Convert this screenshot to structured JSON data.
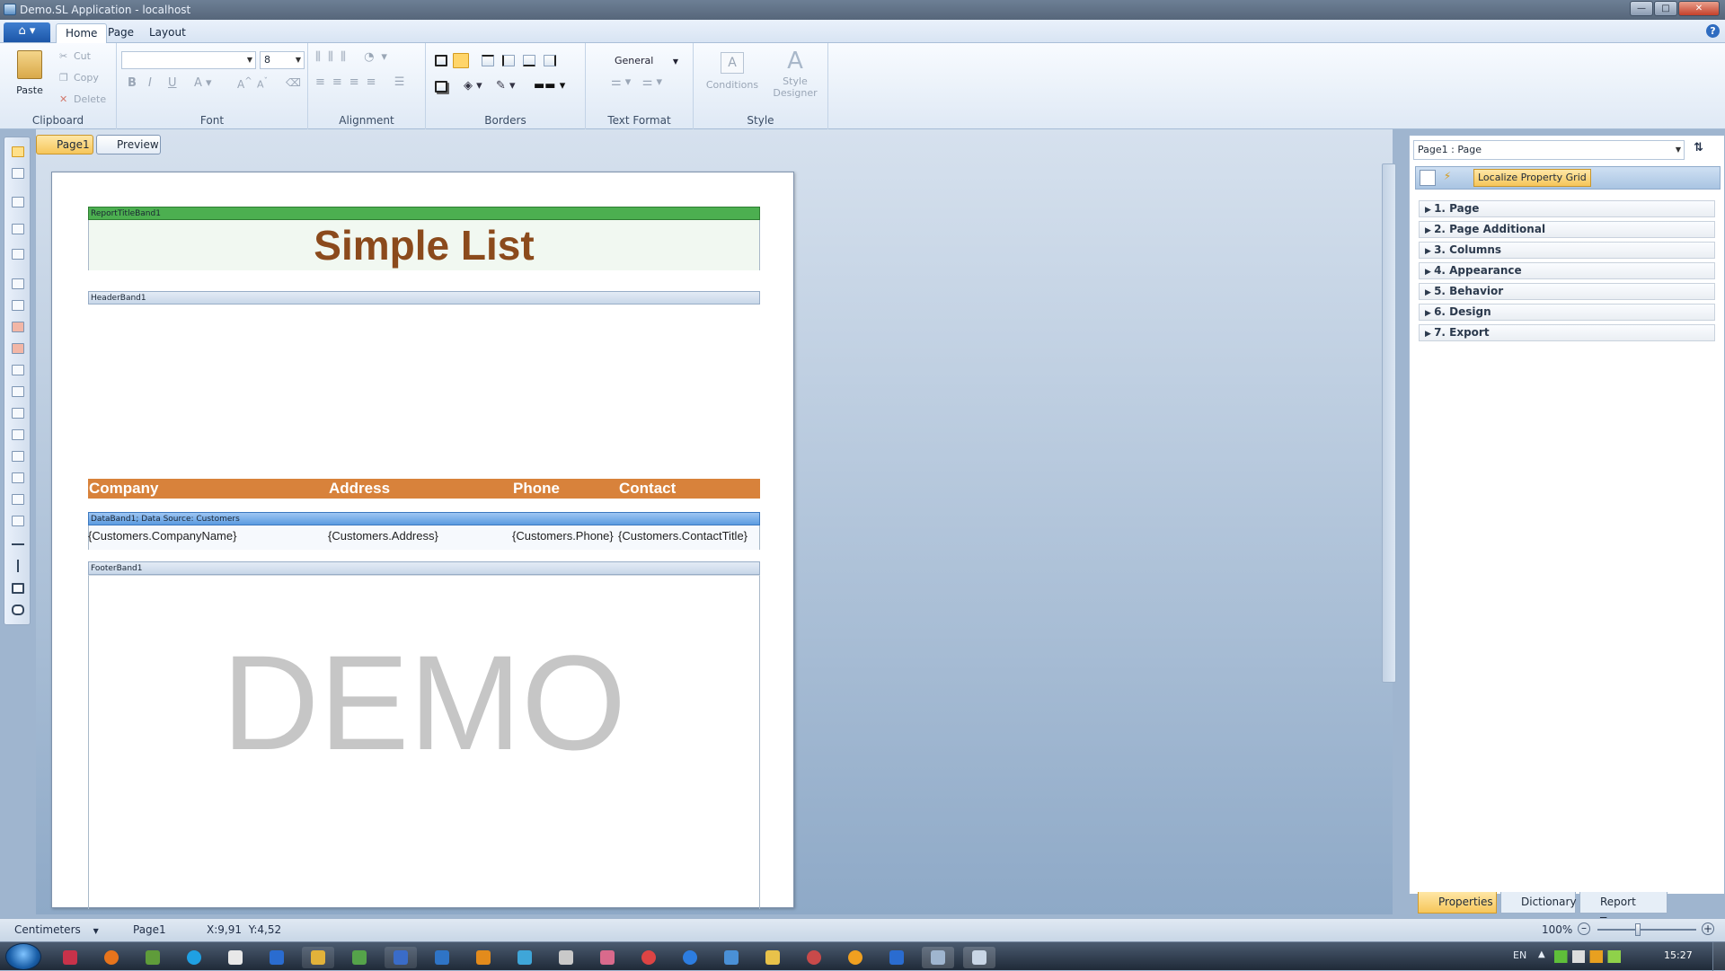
{
  "window": {
    "title": "Demo.SL Application - localhost",
    "minimize": "—",
    "maximize": "□",
    "close": "✕"
  },
  "ribbon": {
    "tabs": [
      "Home",
      "Page",
      "Layout"
    ],
    "help": "?",
    "clipboard": {
      "paste": "Paste",
      "cut": "Cut",
      "copy": "Copy",
      "delete": "Delete",
      "label": "Clipboard"
    },
    "font": {
      "family_value": "",
      "size_value": "8",
      "bold": "B",
      "italic": "I",
      "underline": "U",
      "label": "Font"
    },
    "alignment": {
      "label": "Alignment"
    },
    "borders": {
      "label": "Borders"
    },
    "text_format": {
      "format_value": "General",
      "label": "Text Format"
    },
    "style": {
      "conditions": "Conditions",
      "designer_line1": "Style",
      "designer_line2": "Designer",
      "label": "Style"
    }
  },
  "doc_tabs": {
    "page1": "Page1",
    "preview": "Preview"
  },
  "report": {
    "title_band": "ReportTitleBand1",
    "title": "Simple List",
    "header_band": "HeaderBand1",
    "headers": [
      "Company",
      "Address",
      "Phone",
      "Contact"
    ],
    "data_band": "DataBand1; Data Source: Customers",
    "fields": [
      "{Customers.CompanyName}",
      "{Customers.Address}",
      "{Customers.Phone}",
      "{Customers.ContactTitle}"
    ],
    "footer_band": "FooterBand1",
    "watermark": "DEMO",
    "colors": {
      "title": "#8b4a1c",
      "header": "#d8823b",
      "title_band": "#4caf50",
      "data_band": "#5b9be0"
    }
  },
  "properties": {
    "selector": "Page1 : Page",
    "localize": "Localize Property Grid",
    "categories": [
      "1. Page",
      "2. Page Additional",
      "3. Columns",
      "4. Appearance",
      "5. Behavior",
      "6. Design",
      "7. Export"
    ]
  },
  "panel_tabs": {
    "properties": "Properties",
    "dictionary": "Dictionary",
    "report_tree": "Report Tree"
  },
  "status": {
    "units": "Centimeters",
    "page": "Page1",
    "coords": "X:9,91  Y:4,52",
    "zoom": "100%"
  },
  "taskbar": {
    "lang": "EN",
    "time": "15:27"
  }
}
